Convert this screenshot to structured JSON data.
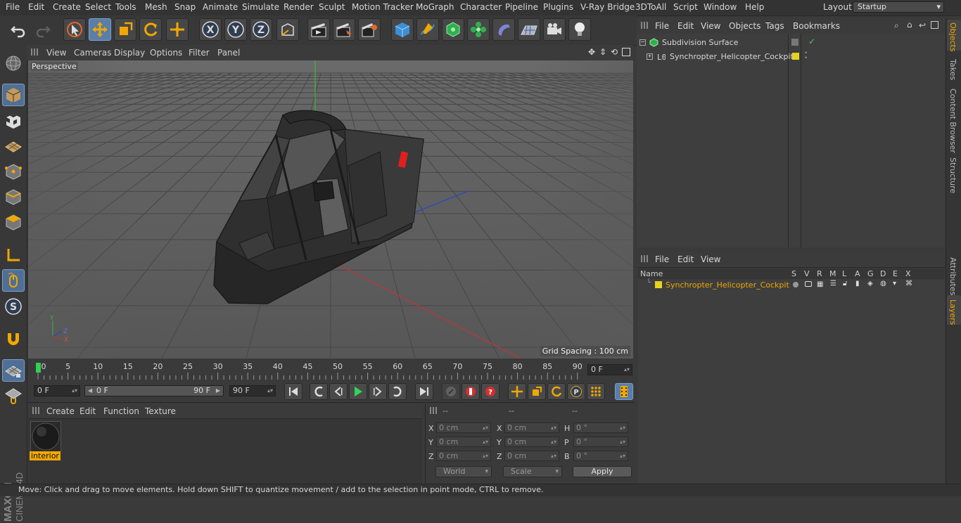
{
  "menubar": {
    "items": [
      "File",
      "Edit",
      "Create",
      "Select",
      "Tools",
      "Mesh",
      "Snap",
      "Animate",
      "Simulate",
      "Render",
      "Sculpt",
      "Motion Tracker",
      "MoGraph",
      "Character",
      "Pipeline",
      "Plugins",
      "V-Ray Bridge",
      "3DToAll",
      "Script",
      "Window",
      "Help"
    ],
    "layout_label": "Layout:",
    "layout_value": "Startup"
  },
  "viewport": {
    "menu": [
      "View",
      "Cameras",
      "Display",
      "Options",
      "Filter",
      "Panel"
    ],
    "label": "Perspective",
    "grid_spacing": "Grid Spacing : 100 cm"
  },
  "timeline": {
    "ticks": [
      "0",
      "5",
      "10",
      "15",
      "20",
      "25",
      "30",
      "35",
      "40",
      "45",
      "50",
      "55",
      "60",
      "65",
      "70",
      "75",
      "80",
      "85",
      "90"
    ],
    "current_frame": "0 F"
  },
  "playback": {
    "start_field": "0 F",
    "range_start": "0 F",
    "range_end": "90 F",
    "end_field": "90 F"
  },
  "material_manager": {
    "menu": [
      "Create",
      "Edit",
      "Function",
      "Texture"
    ],
    "material_name": "interior"
  },
  "coordinates": {
    "headers": [
      "--",
      "--",
      "--"
    ],
    "rows": [
      {
        "a1": "X",
        "v1": "0 cm",
        "a2": "X",
        "v2": "0 cm",
        "a3": "H",
        "v3": "0 °"
      },
      {
        "a1": "Y",
        "v1": "0 cm",
        "a2": "Y",
        "v2": "0 cm",
        "a3": "P",
        "v3": "0 °"
      },
      {
        "a1": "Z",
        "v1": "0 cm",
        "a2": "Z",
        "v2": "0 cm",
        "a3": "B",
        "v3": "0 °"
      }
    ],
    "world": "World",
    "scale": "Scale",
    "apply": "Apply"
  },
  "object_manager": {
    "menu": [
      "File",
      "Edit",
      "View",
      "Objects",
      "Tags",
      "Bookmarks"
    ],
    "objects": [
      "Subdivision Surface",
      "Synchropter_Helicopter_Cockpit"
    ]
  },
  "layer_manager": {
    "menu": [
      "File",
      "Edit",
      "View"
    ],
    "headers": [
      "Name",
      "S",
      "V",
      "R",
      "M",
      "L",
      "A",
      "G",
      "D",
      "E",
      "X"
    ],
    "layer_name": "Synchropter_Helicopter_Cockpit"
  },
  "right_tabs": [
    "Objects",
    "Takes",
    "Content Browser",
    "Structure",
    "Attributes",
    "Layers"
  ],
  "status": "Move: Click and drag to move elements. Hold down SHIFT to quantize movement / add to the selection in point mode, CTRL to remove.",
  "colors": {
    "accent": "#f0a800",
    "highlight": "#5a7ea8",
    "layer_yellow": "#e6d21e"
  }
}
